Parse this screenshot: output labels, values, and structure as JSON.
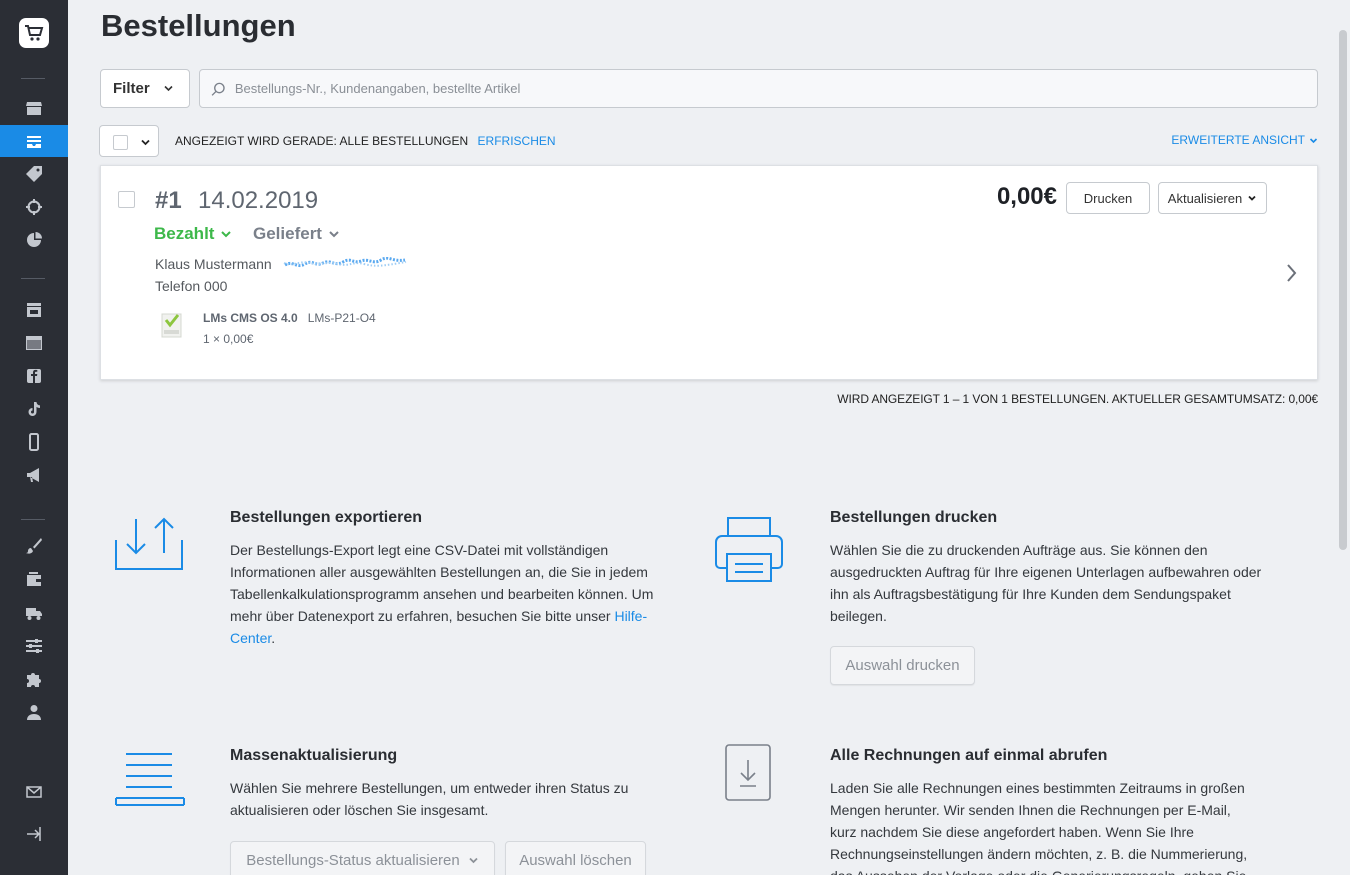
{
  "page": {
    "title": "Bestellungen"
  },
  "toolbar": {
    "filter_label": "Filter",
    "search_placeholder": "Bestellungs-Nr., Kundenangaben, bestellte Artikel",
    "showing_text": "ANGEZEIGT WIRD GERADE: ALLE BESTELLUNGEN",
    "refresh_label": "ERFRISCHEN",
    "extended_view_label": "ERWEITERTE ANSICHT"
  },
  "order": {
    "number": "#1",
    "date": "14.02.2019",
    "payment_status": "Bezahlt",
    "delivery_status": "Geliefert",
    "customer_name": "Klaus Mustermann",
    "phone": "Telefon 000",
    "product_name": "LMs CMS OS 4.0",
    "product_sku": "LMs-P21-O4",
    "quantity_price": "1 × 0,00€",
    "total": "0,00€",
    "print_label": "Drucken",
    "update_label": "Aktualisieren"
  },
  "summary": "WIRD ANGEZEIGT 1 – 1 VON 1 BESTELLUNGEN. AKTUELLER GESAMTUMSATZ: 0,00€",
  "features": {
    "export": {
      "title": "Bestellungen exportieren",
      "text": "Der Bestellungs-Export legt eine CSV-Datei mit vollständigen Informationen aller ausgewählten Bestellungen an, die Sie in jedem Tabellenkalkulationsprogramm ansehen und bearbeiten können. Um mehr über Datenexport zu erfahren, besuchen Sie bitte unser ",
      "link": "Hilfe-Center",
      "after": "."
    },
    "print": {
      "title": "Bestellungen drucken",
      "text": "Wählen Sie die zu druckenden Aufträge aus. Sie können den ausgedruckten Auftrag für Ihre eigenen Unterlagen aufbewahren oder ihn als Auftragsbestätigung für Ihre Kunden dem Sendungspaket beilegen.",
      "button": "Auswahl drucken"
    },
    "mass": {
      "title": "Massenaktualisierung",
      "text": "Wählen Sie mehrere Bestellungen, um entweder ihren Status zu aktualisieren oder löschen Sie insgesamt.",
      "status_button": "Bestellungs-Status aktualisieren",
      "delete_button": "Auswahl löschen"
    },
    "invoices": {
      "title": "Alle Rechnungen auf einmal abrufen",
      "text": "Laden Sie alle Rechnungen eines bestimmten Zeitraums in großen Mengen herunter. Wir senden Ihnen die Rechnungen per E-Mail, kurz nachdem Sie diese angefordert haben. Wenn Sie Ihre Rechnungseinstellungen ändern möchten, z. B. die Nummerierung, das Aussehen der Vorlage oder die Generierungsregeln, gehen Sie zu"
    }
  },
  "sidebar": {
    "items": [
      "store-icon",
      "orders-icon",
      "tag-icon",
      "target-icon",
      "pie-chart-icon",
      "storefront-icon",
      "browser-icon",
      "facebook-icon",
      "tiktok-icon",
      "mobile-icon",
      "megaphone-icon",
      "brush-icon",
      "wallet-icon",
      "truck-icon",
      "sliders-icon",
      "puzzle-icon",
      "user-icon",
      "mail-icon",
      "logout-icon"
    ]
  },
  "colors": {
    "accent": "#1a8be6",
    "paid": "#3db84a",
    "sidebar": "#2b2e35"
  }
}
